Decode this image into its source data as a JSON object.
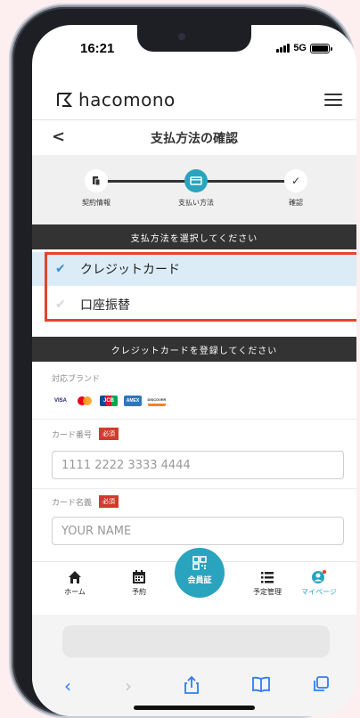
{
  "status_bar": {
    "time": "16:21",
    "network": "5G"
  },
  "header": {
    "brand": "hacomono"
  },
  "page": {
    "title": "支払方法の確認",
    "back": "<"
  },
  "steps": [
    {
      "label": "契約情報",
      "icon": "document-icon",
      "state": "done"
    },
    {
      "label": "支払い方法",
      "icon": "credit-card-icon",
      "state": "current"
    },
    {
      "label": "確認",
      "icon": "check-icon",
      "state": "done"
    }
  ],
  "payment_section": {
    "heading": "支払方法を選択してください",
    "options": [
      {
        "label": "クレジットカード",
        "selected": true
      },
      {
        "label": "口座振替",
        "selected": false
      }
    ]
  },
  "card_section": {
    "heading": "クレジットカードを登録してください",
    "brands_label": "対応ブランド",
    "brands": [
      "VISA",
      "Mastercard",
      "JCB",
      "AMEX",
      "DISCOVER"
    ],
    "required_badge": "必須",
    "card_number": {
      "label": "カード番号",
      "placeholder": "1111 2222 3333 4444"
    },
    "card_name": {
      "label": "カード名義",
      "placeholder": "YOUR NAME"
    }
  },
  "tabbar": {
    "items": [
      {
        "label": "ホーム",
        "icon": "home-icon"
      },
      {
        "label": "予約",
        "icon": "calendar-icon"
      },
      {
        "label": "会員証",
        "icon": "qr-code-icon"
      },
      {
        "label": "予定管理",
        "icon": "list-icon"
      },
      {
        "label": "マイページ",
        "icon": "user-icon"
      }
    ]
  },
  "colors": {
    "accent": "#2aa3bf",
    "selected_bg": "#dcecf6",
    "highlight": "#e5432b",
    "dark": "#333333"
  }
}
